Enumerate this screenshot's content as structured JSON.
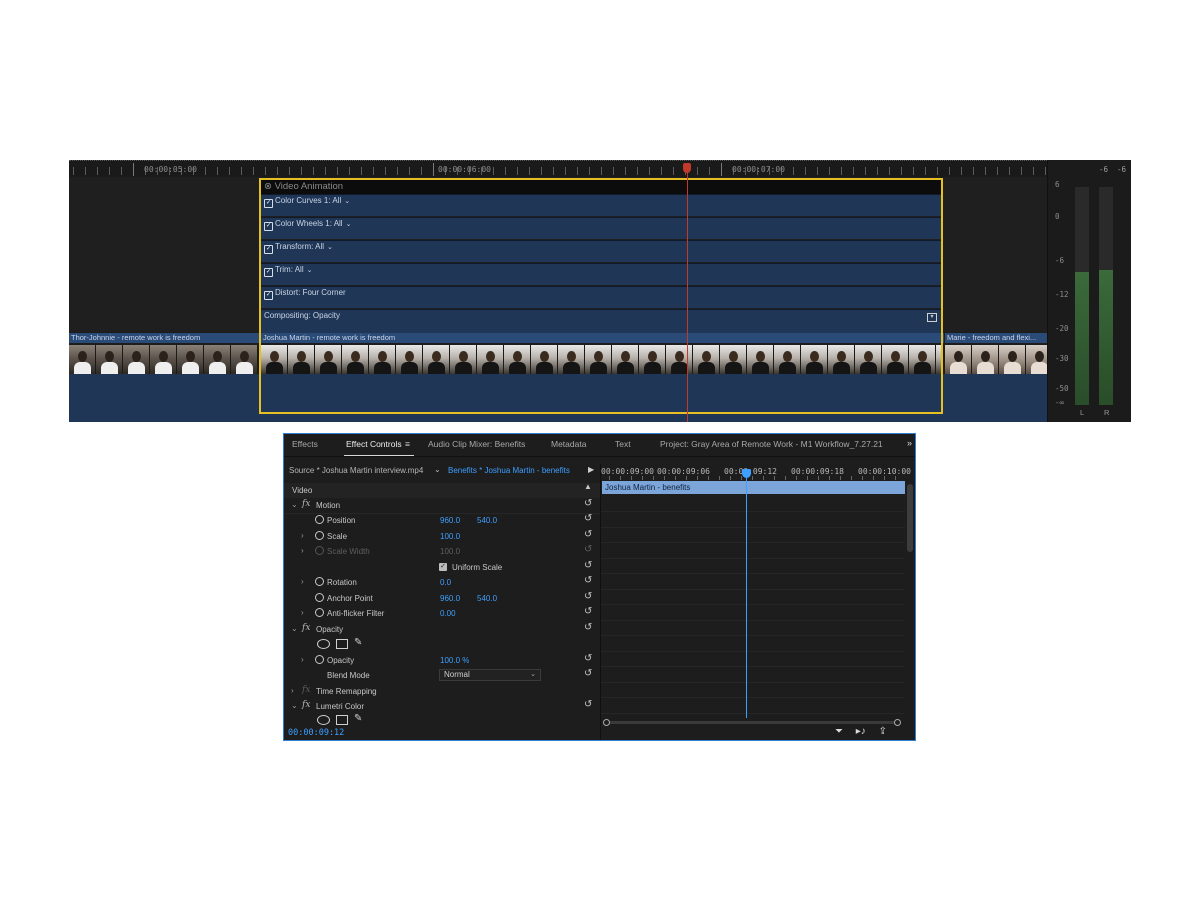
{
  "timeline": {
    "ruler_timecodes": [
      "00:00:05:00",
      "00:00:06:00",
      "00:00:07:00"
    ],
    "fx_title": "Video Animation",
    "fx_rows": [
      {
        "label": "Color Curves 1: All",
        "checked": true,
        "dropdown": true
      },
      {
        "label": "Color Wheels 1: All",
        "checked": true,
        "dropdown": true
      },
      {
        "label": "Transform: All",
        "checked": true,
        "dropdown": true
      },
      {
        "label": "Trim: All",
        "checked": true,
        "dropdown": true
      },
      {
        "label": "Distort: Four Corner",
        "checked": true,
        "dropdown": false
      },
      {
        "label": "Compositing: Opacity",
        "checked": false,
        "dropdown": false
      }
    ],
    "clips": [
      {
        "name": "Thor-Johnnie - remote work is freedom"
      },
      {
        "name": "Joshua Martin - remote work is freedom"
      },
      {
        "name": "Marie - freedom and flexi..."
      }
    ],
    "meter_scale": [
      "6",
      "0",
      "-6",
      "-12",
      "-20",
      "-30",
      "-50",
      "-∞"
    ],
    "meter_peaks": [
      "-6",
      "-6"
    ],
    "meter_channels": [
      "L",
      "R"
    ],
    "meter_levels": [
      0.61,
      0.62
    ],
    "colors": {
      "selection": "#e6c022",
      "playhead": "#c0392b",
      "clip": "#1f3657"
    }
  },
  "effect_controls": {
    "tabs": [
      {
        "label": "Effects",
        "active": false
      },
      {
        "label": "Effect Controls",
        "active": true
      },
      {
        "label": "Audio Clip Mixer: Benefits",
        "active": false
      },
      {
        "label": "Metadata",
        "active": false
      },
      {
        "label": "Text",
        "active": false
      },
      {
        "label": "Project: Gray Area of Remote Work - M1 Workflow_7.27.21",
        "active": false
      }
    ],
    "tabs_more": "»",
    "tab_menu_icon": "≡",
    "source_label": "Source * Joshua Martin interview.mp4",
    "sequence_label": "Benefits * Joshua Martin - benefits",
    "section_video": "Video",
    "fx_motion": "Motion",
    "position_label": "Position",
    "position_x": "960.0",
    "position_y": "540.0",
    "scale_label": "Scale",
    "scale_value": "100.0",
    "scale_width_label": "Scale Width",
    "scale_width_value": "100.0",
    "uniform_scale_label": "Uniform Scale",
    "uniform_scale_checked": true,
    "rotation_label": "Rotation",
    "rotation_value": "0.0",
    "anchor_label": "Anchor Point",
    "anchor_x": "960.0",
    "anchor_y": "540.0",
    "antiflicker_label": "Anti-flicker Filter",
    "antiflicker_value": "0.00",
    "fx_opacity": "Opacity",
    "opacity_label": "Opacity",
    "opacity_value": "100.0 %",
    "blend_label": "Blend Mode",
    "blend_value": "Normal",
    "time_remap_label": "Time Remapping",
    "lumetri_label": "Lumetri Color",
    "fx_symbol": "fx",
    "current_timecode": "00:00:09:12",
    "mini_timecodes": [
      "00:00:09:00",
      "00:00:09:06",
      "00:00:09:12",
      "00:00:09:18",
      "00:00:10:00"
    ],
    "mini_clip_name": "Joshua Martin - benefits",
    "accent_color": "#3d9fff",
    "mini_clip_color": "#7ca5d9"
  }
}
